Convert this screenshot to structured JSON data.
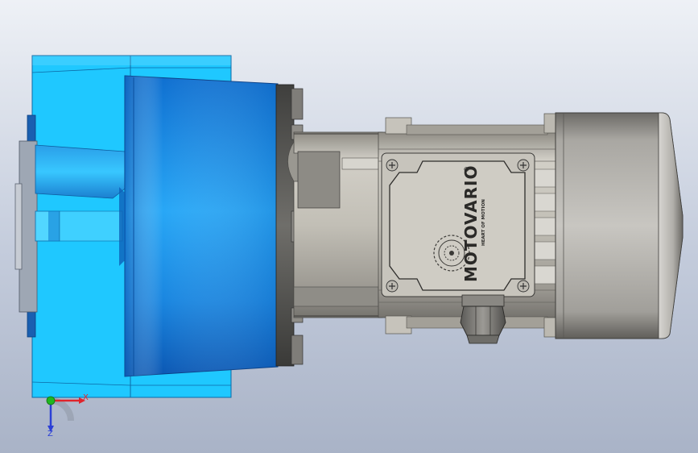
{
  "model": {
    "brand_name": "MOTOVARIO",
    "registered_mark": "®",
    "tagline": "HEART OF MOTION"
  },
  "triad": {
    "x_label": "X",
    "z_label": "Z"
  },
  "colors": {
    "background_top": "#eef1f6",
    "background_bottom": "#a9b3c7",
    "housing_blue": "#1fc8ff",
    "flange_blue": "#1a8fe6",
    "motor_grey": "#b9b6ad",
    "fan_cover_grey": "#8c8a86",
    "axis_x": "#e0242c",
    "axis_y": "#1fb71f",
    "axis_z": "#2b3fd6"
  }
}
